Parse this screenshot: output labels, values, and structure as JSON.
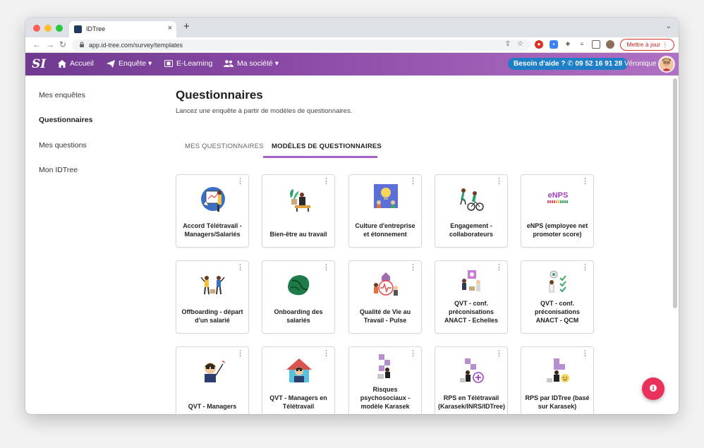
{
  "browser": {
    "tab_title": "IDTree",
    "tab_close": "×",
    "new_tab": "+",
    "url": "app.id-tree.com/survey/templates",
    "update_button": "Mettre à jour",
    "update_menu": "⋮",
    "nav_back": "←",
    "nav_forward": "→",
    "nav_reload": "↻"
  },
  "app": {
    "logo": "SI",
    "nav": {
      "accueil": "Accueil",
      "enquete": "Enquête ▾",
      "elearning": "E-Learning",
      "societe": "Ma société ▾"
    },
    "help": "Besoin d'aide ? ✆ 09 52 16 91 28",
    "user": "Véronique"
  },
  "sidebar": {
    "items": [
      {
        "label": "Mes enquêtes"
      },
      {
        "label": "Questionnaires"
      },
      {
        "label": "Mes questions"
      },
      {
        "label": "Mon IDTree"
      }
    ]
  },
  "main": {
    "title": "Questionnaires",
    "subtitle": "Lancez une enquête à partir de modèles de questionnaires.",
    "tabs": [
      {
        "label": "MES QUESTIONNAIRES"
      },
      {
        "label": "MODÈLES DE QUESTIONNAIRES"
      }
    ],
    "cards": [
      {
        "label": "Accord Télétravail - Managers/Salariés",
        "icon": "teletravail-illustration"
      },
      {
        "label": "Bien-être au travail",
        "icon": "wellbeing-illustration"
      },
      {
        "label": "Culture d'entreprise et étonnement",
        "icon": "culture-illustration"
      },
      {
        "label": "Engagement - collaborateurs",
        "icon": "engagement-illustration"
      },
      {
        "label": "eNPS (employee net promoter score)",
        "icon": "enps-illustration",
        "badge": "eNPS"
      },
      {
        "label": "Offboarding - départ d'un salarié",
        "icon": "offboarding-illustration"
      },
      {
        "label": "Onboarding des salariés",
        "icon": "onboarding-illustration"
      },
      {
        "label": "Qualité de Vie au Travail - Pulse",
        "icon": "qvt-pulse-illustration"
      },
      {
        "label": "QVT - conf. préconisations ANACT - Echelles",
        "icon": "qvt-echelles-illustration"
      },
      {
        "label": "QVT - conf. préconisations ANACT - QCM",
        "icon": "qvt-qcm-illustration"
      },
      {
        "label": "QVT - Managers",
        "icon": "qvt-managers-illustration"
      },
      {
        "label": "QVT - Managers en Télétravail",
        "icon": "qvt-teletravail-illustration"
      },
      {
        "label": "Risques psychosociaux - modèle Karasek",
        "icon": "rps-karasek-illustration"
      },
      {
        "label": "RPS en Télétravail (Karasek/INRS/IDTree)",
        "icon": "rps-teletravail-illustration"
      },
      {
        "label": "RPS par IDTree (basé sur Karasek)",
        "icon": "rps-idtree-illustration"
      }
    ]
  },
  "colors": {
    "brand_gradient_start": "#6f3a8f",
    "brand_gradient_end": "#b071c4",
    "tab_underline": "#a660c9",
    "help_blue": "#1e7fc7",
    "fab_red": "#e8325c"
  }
}
